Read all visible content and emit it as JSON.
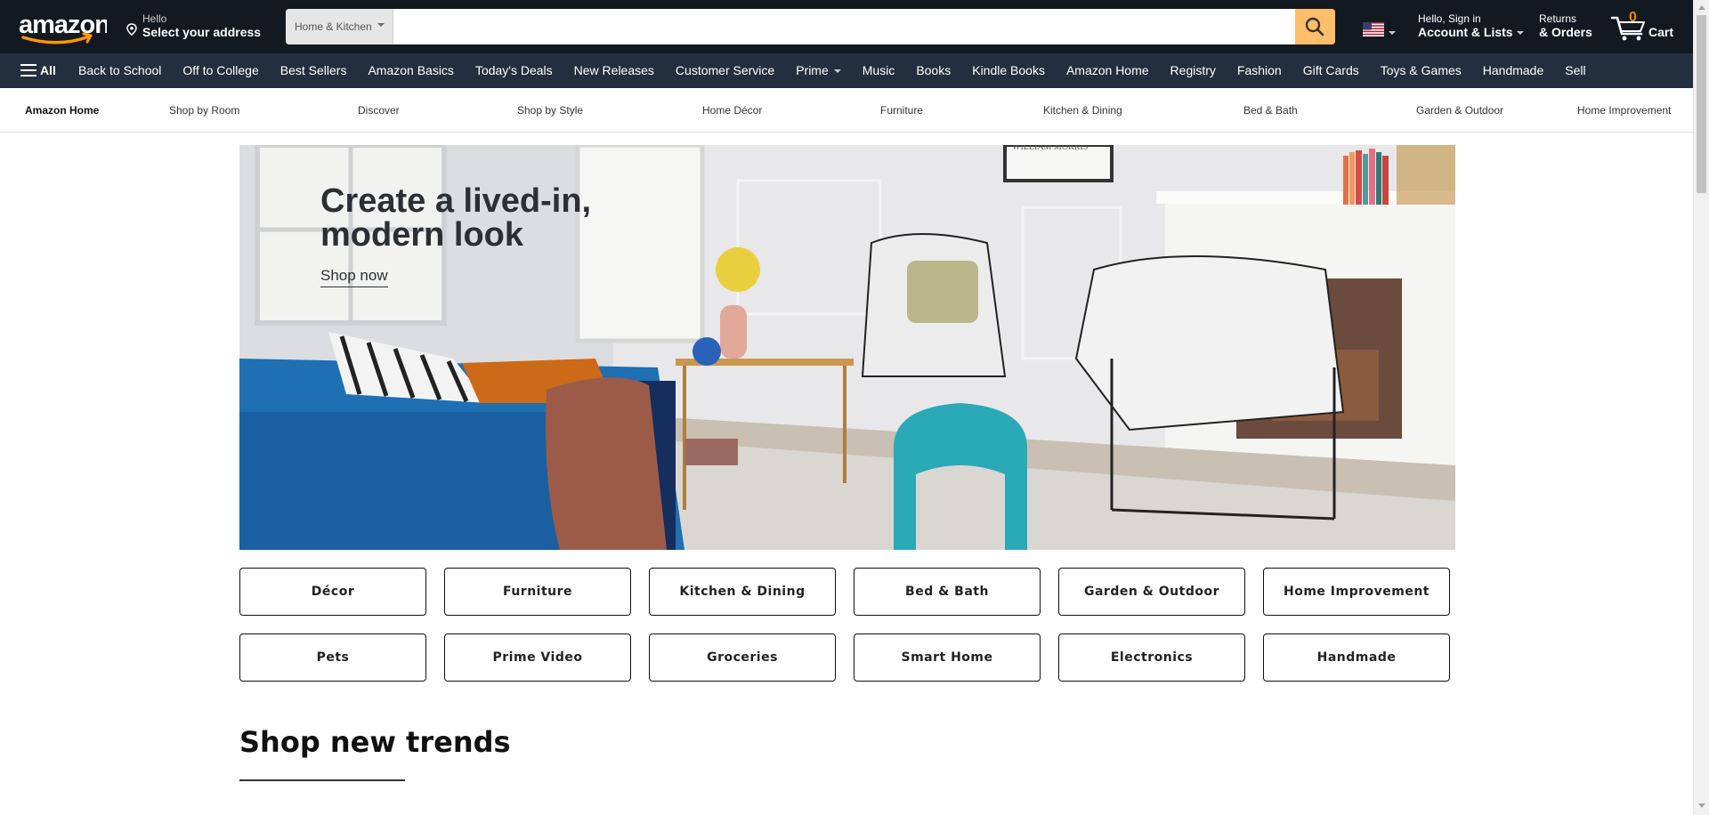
{
  "header": {
    "logo_text": "amazon",
    "location": {
      "line1": "Hello",
      "line2": "Select your address",
      "icon": "location-pin-icon"
    },
    "search": {
      "category": "Home & Kitchen",
      "value": "",
      "placeholder": "",
      "button_icon": "search-icon"
    },
    "flag_icon": "us-flag-icon",
    "account": {
      "line1": "Hello, Sign in",
      "line2": "Account & Lists"
    },
    "orders": {
      "line1": "Returns",
      "line2": "& Orders"
    },
    "cart": {
      "count": "0",
      "label": "Cart",
      "icon": "cart-icon"
    }
  },
  "nav": {
    "all_label": "All",
    "links": [
      {
        "label": "Back to School"
      },
      {
        "label": "Off to College"
      },
      {
        "label": "Best Sellers"
      },
      {
        "label": "Amazon Basics"
      },
      {
        "label": "Today's Deals"
      },
      {
        "label": "New Releases"
      },
      {
        "label": "Customer Service"
      },
      {
        "label": "Prime"
      },
      {
        "label": "Music"
      },
      {
        "label": "Books"
      },
      {
        "label": "Kindle Books"
      },
      {
        "label": "Amazon Home"
      },
      {
        "label": "Registry"
      },
      {
        "label": "Fashion"
      },
      {
        "label": "Gift Cards"
      },
      {
        "label": "Toys & Games"
      },
      {
        "label": "Handmade"
      },
      {
        "label": "Sell"
      }
    ]
  },
  "store_nav": {
    "items": [
      {
        "label": "Amazon Home"
      },
      {
        "label": "Shop by Room"
      },
      {
        "label": "Discover"
      },
      {
        "label": "Shop by Style"
      },
      {
        "label": "Home Décor"
      },
      {
        "label": "Furniture"
      },
      {
        "label": "Kitchen & Dining"
      },
      {
        "label": "Bed & Bath"
      },
      {
        "label": "Garden & Outdoor"
      },
      {
        "label": "Home Improvement"
      }
    ]
  },
  "hero": {
    "title": "Create a lived-in, modern look",
    "cta": "Shop now",
    "poster_text": "WILLIAM MORRIS"
  },
  "categories": {
    "row1": [
      {
        "label": "Décor"
      },
      {
        "label": "Furniture"
      },
      {
        "label": "Kitchen & Dining"
      },
      {
        "label": "Bed & Bath"
      },
      {
        "label": "Garden & Outdoor"
      },
      {
        "label": "Home Improvement"
      }
    ],
    "row2": [
      {
        "label": "Pets"
      },
      {
        "label": "Prime Video"
      },
      {
        "label": "Groceries"
      },
      {
        "label": "Smart Home"
      },
      {
        "label": "Electronics"
      },
      {
        "label": "Handmade"
      }
    ]
  },
  "section": {
    "title": "Shop new trends"
  },
  "colors": {
    "nav_belt": "#131921",
    "nav_main": "#232f3e",
    "search_button": "#febd69",
    "cart_count": "#f08804"
  }
}
